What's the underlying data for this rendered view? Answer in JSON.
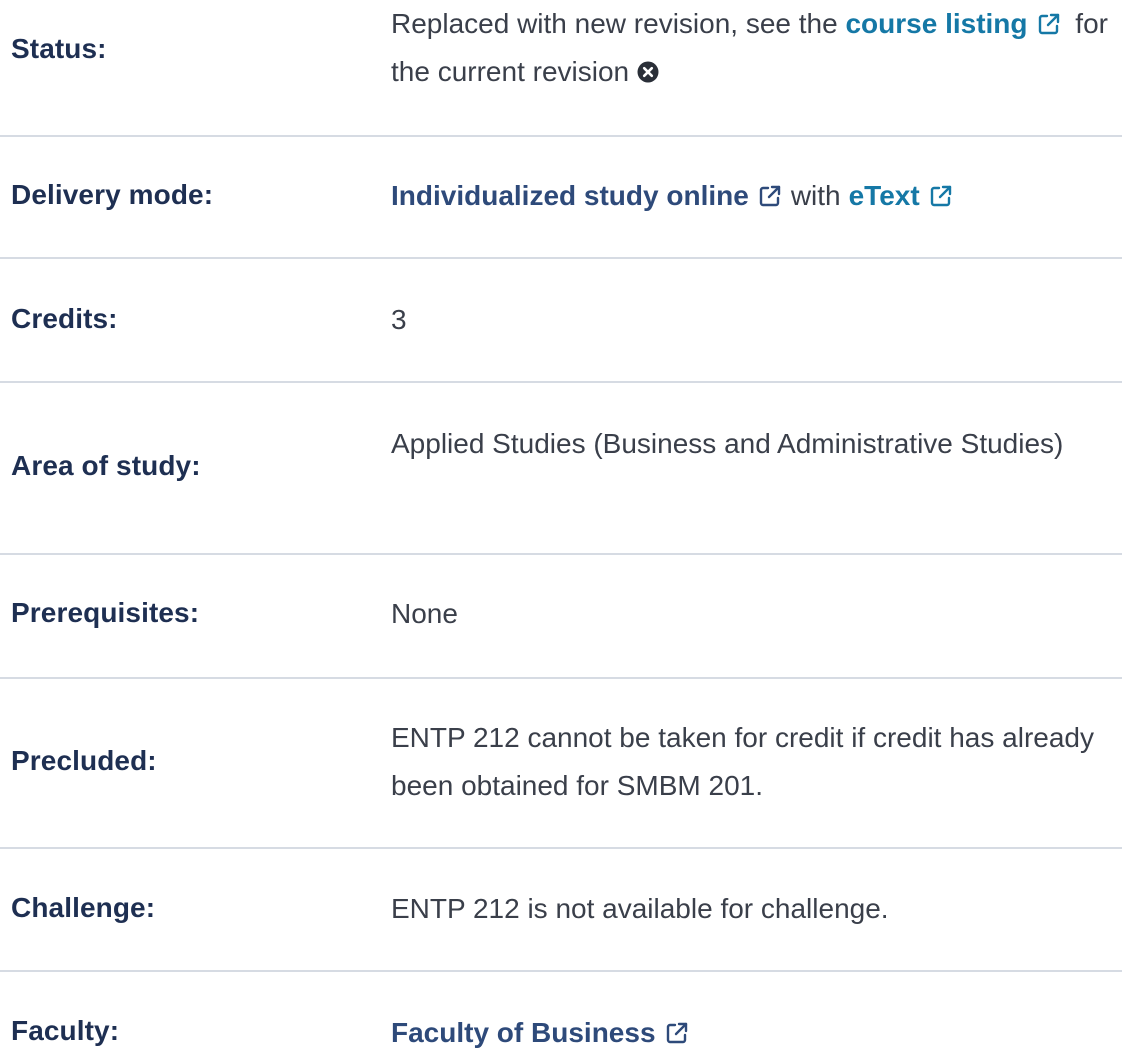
{
  "rows": {
    "status": {
      "label": "Status:",
      "text_before": "Replaced with new revision, see the ",
      "link_text": "course listing",
      "text_after": " for the current revision"
    },
    "delivery_mode": {
      "label": "Delivery mode:",
      "link1_text": "Individualized study online",
      "middle_text": "with",
      "link2_text": "eText"
    },
    "credits": {
      "label": "Credits:",
      "value": "3"
    },
    "area_of_study": {
      "label": "Area of study:",
      "value": "Applied Studies (Business and Administrative Studies)"
    },
    "prerequisites": {
      "label": "Prerequisites:",
      "value": "None"
    },
    "precluded": {
      "label": "Precluded:",
      "value": "ENTP 212 cannot be taken for credit if credit has already been obtained for SMBM 201."
    },
    "challenge": {
      "label": "Challenge:",
      "value": "ENTP 212 is not available for challenge."
    },
    "faculty": {
      "label": "Faculty:",
      "link_text": "Faculty of Business"
    }
  },
  "icons": {
    "external_link": "external-link-icon",
    "close": "close-circle-icon"
  },
  "colors": {
    "label": "#1e2f52",
    "link": "#1578a6",
    "link_dark": "#2e4a7a",
    "text": "#3a3f4a",
    "divider": "#d6dbe3"
  }
}
